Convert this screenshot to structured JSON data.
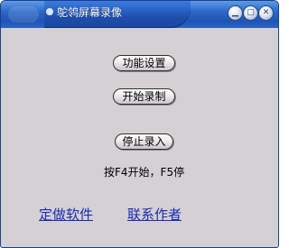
{
  "window": {
    "title": "鸵鸰屏幕录像",
    "min_glyph": "▁",
    "max_glyph": "▢",
    "close_glyph": "✕"
  },
  "buttons": {
    "settings": "功能设置",
    "start": "开始录制",
    "stop": "停止录入"
  },
  "hint": "按F4开始，F5停",
  "links": {
    "custom": "定做软件",
    "author": "联系作者"
  }
}
